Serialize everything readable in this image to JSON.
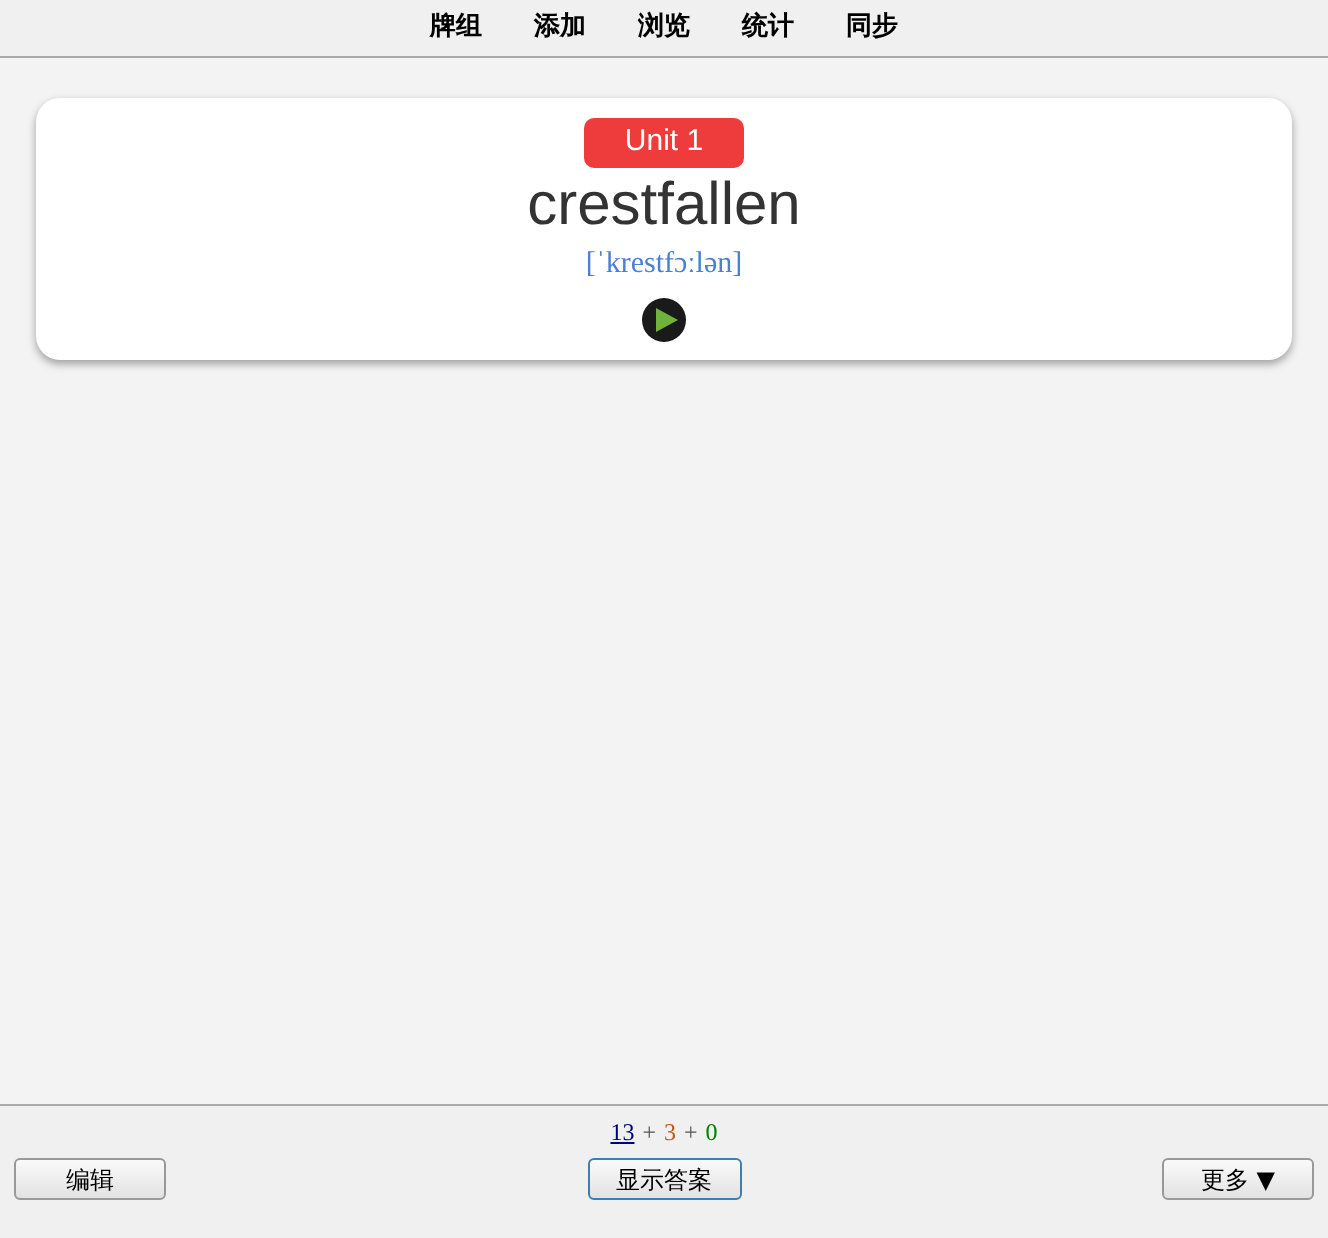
{
  "menu": [
    {
      "label": "牌组"
    },
    {
      "label": "添加"
    },
    {
      "label": "浏览"
    },
    {
      "label": "统计"
    },
    {
      "label": "同步"
    }
  ],
  "card": {
    "tag": "Unit 1",
    "word": "crestfallen",
    "phonetic": "[ˈkrestfɔːlən]"
  },
  "counts": [
    {
      "kind": "count",
      "text": "13",
      "color": "#000080",
      "selected": true
    },
    {
      "kind": "separator",
      "text": "+"
    },
    {
      "kind": "count",
      "text": "3",
      "color": "#c35617",
      "selected": false
    },
    {
      "kind": "separator",
      "text": "+"
    },
    {
      "kind": "count",
      "text": "0",
      "color": "#008000",
      "selected": false
    }
  ],
  "buttons": {
    "left": "编辑",
    "center": "显示答案",
    "right": "更多 ▼"
  }
}
